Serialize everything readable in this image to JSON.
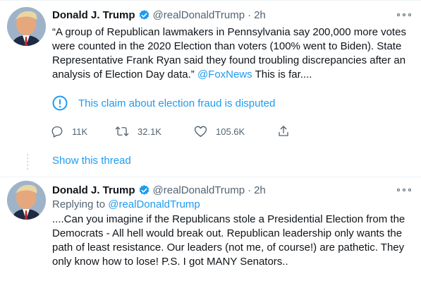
{
  "tweets": [
    {
      "name": "Donald J. Trump",
      "handle": "@realDonaldTrump",
      "separator": "·",
      "time": "2h",
      "text": "“A group of Republican lawmakers in Pennsylvania say 200,000 more votes were counted in the 2020 Election than voters (100% went to Biden). State Representative Frank Ryan said they found troubling discrepancies after an analysis of Election Day data.” ",
      "mention": "@FoxNews",
      "text_tail": " This is far....",
      "notice": "This claim about election fraud is disputed",
      "reply_count": "11K",
      "retweet_count": "32.1K",
      "like_count": "105.6K",
      "show_thread": "Show this thread"
    },
    {
      "name": "Donald J. Trump",
      "handle": "@realDonaldTrump",
      "separator": "·",
      "time": "2h",
      "replying_to_label": "Replying to ",
      "replying_to_handle": "@realDonaldTrump",
      "text": "....Can you imagine if the Republicans stole a Presidential Election from the Democrats - All hell would break out. Republican leadership only wants the path of least resistance. Our leaders (not me, of course!) are pathetic. They only know how to lose! P.S. I got MANY Senators.."
    }
  ],
  "colors": {
    "accent": "#1d9bf0",
    "text": "#0f1419",
    "muted": "#536471",
    "divider": "#eff3f4"
  },
  "icons": {
    "verified": "verified-badge-icon",
    "more": "more-dots-icon",
    "notice": "exclamation-circle-icon",
    "reply": "reply-bubble-icon",
    "retweet": "retweet-icon",
    "like": "heart-icon",
    "share": "share-icon"
  }
}
